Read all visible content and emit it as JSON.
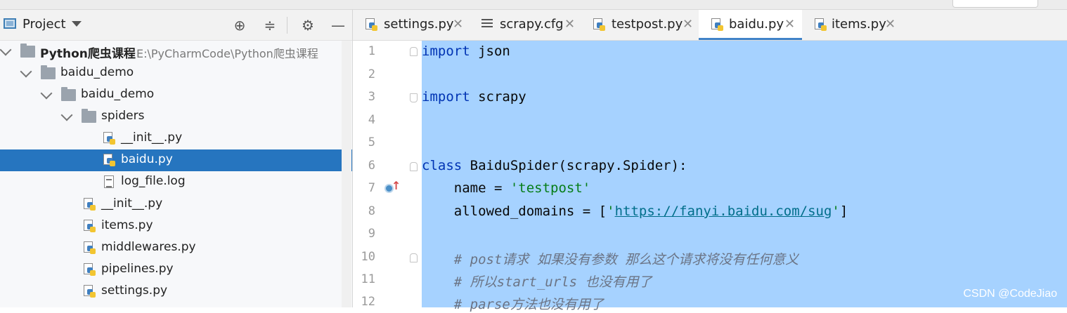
{
  "project_panel": {
    "title": "Project",
    "toolbar": {
      "locate_icon": "crosshair-icon",
      "collapse_icon": "collapse-all-icon",
      "settings_icon": "gear-icon",
      "hide_icon": "minimize-icon"
    },
    "tree": [
      {
        "label": "Python爬虫课程",
        "path": "E:\\PyCharmCode\\Python爬虫课程",
        "type": "folder",
        "depth": 0,
        "expanded": true,
        "bold": true
      },
      {
        "label": "baidu_demo",
        "type": "folder",
        "depth": 1,
        "expanded": true
      },
      {
        "label": "baidu_demo",
        "type": "folder",
        "depth": 2,
        "expanded": true
      },
      {
        "label": "spiders",
        "type": "folder",
        "depth": 3,
        "expanded": true
      },
      {
        "label": "__init__.py",
        "type": "python",
        "depth": 4
      },
      {
        "label": "baidu.py",
        "type": "python",
        "depth": 4,
        "selected": true
      },
      {
        "label": "log_file.log",
        "type": "log",
        "depth": 4
      },
      {
        "label": "__init__.py",
        "type": "python",
        "depth": 3
      },
      {
        "label": "items.py",
        "type": "python",
        "depth": 3
      },
      {
        "label": "middlewares.py",
        "type": "python",
        "depth": 3
      },
      {
        "label": "pipelines.py",
        "type": "python",
        "depth": 3
      },
      {
        "label": "settings.py",
        "type": "python",
        "depth": 3
      }
    ]
  },
  "editor": {
    "tabs": [
      {
        "label": "settings.py",
        "icon": "python-file-icon",
        "active": false
      },
      {
        "label": "scrapy.cfg",
        "icon": "config-file-icon",
        "active": false
      },
      {
        "label": "testpost.py",
        "icon": "python-file-icon",
        "active": false
      },
      {
        "label": "baidu.py",
        "icon": "python-file-icon",
        "active": true
      },
      {
        "label": "items.py",
        "icon": "python-file-icon",
        "active": false
      }
    ],
    "line_numbers": [
      "1",
      "2",
      "3",
      "4",
      "5",
      "6",
      "7",
      "8",
      "9",
      "10",
      "11",
      "12"
    ],
    "code": {
      "l1_kw": "import",
      "l1_rest": " json",
      "l3_kw": "import",
      "l3_rest": " scrapy",
      "l6_kw": "class",
      "l6_rest": " BaiduSpider(scrapy.Spider):",
      "l7_a": "    name = ",
      "l7_str": "'testpost'",
      "l8_a": "    allowed_domains = [",
      "l8_q1": "'",
      "l8_url": "https://fanyi.baidu.com/sug",
      "l8_q2": "'",
      "l8_b": "]",
      "l10": "    # post请求 如果没有参数 那么这个请求将没有任何意义",
      "l11": "    # 所以start_urls 也没有用了",
      "l12": "    # parse方法也没有用了"
    },
    "selection_color": "#a6d2ff"
  },
  "watermark": "CSDN @CodeJiao",
  "colors": {
    "selected_row": "#2675bf",
    "keyword": "#0033b3",
    "string": "#067d17"
  }
}
